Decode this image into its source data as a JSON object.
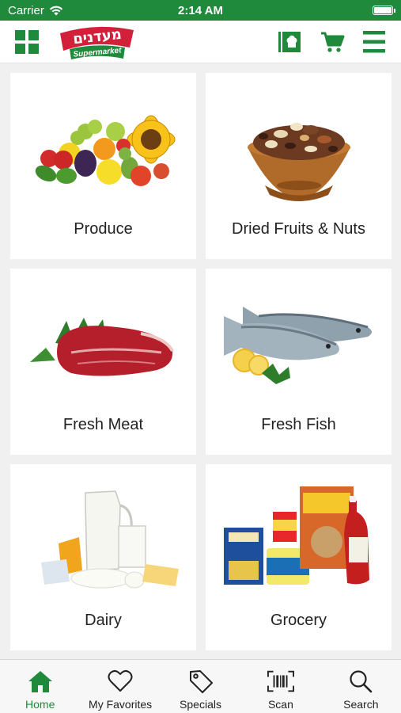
{
  "status_bar": {
    "carrier": "Carrier",
    "time": "2:14 AM"
  },
  "header": {
    "logo_text": "מעדנים",
    "logo_subtext": "Supermarket",
    "accent_color": "#1f8a3c",
    "icons": [
      "grid-menu-icon",
      "chef-book-icon",
      "cart-icon",
      "hamburger-menu-icon"
    ]
  },
  "categories": [
    {
      "label": "Produce",
      "icon": "produce-image"
    },
    {
      "label": "Dried Fruits & Nuts",
      "icon": "nuts-bowl-image"
    },
    {
      "label": "Fresh Meat",
      "icon": "meat-image"
    },
    {
      "label": "Fresh Fish",
      "icon": "fish-image"
    },
    {
      "label": "Dairy",
      "icon": "dairy-image"
    },
    {
      "label": "Grocery",
      "icon": "grocery-image"
    }
  ],
  "tabs": [
    {
      "label": "Home",
      "icon": "home-icon",
      "active": true
    },
    {
      "label": "My Favorites",
      "icon": "heart-icon",
      "active": false
    },
    {
      "label": "Specials",
      "icon": "tag-icon",
      "active": false
    },
    {
      "label": "Scan",
      "icon": "barcode-icon",
      "active": false
    },
    {
      "label": "Search",
      "icon": "search-icon",
      "active": false
    }
  ]
}
